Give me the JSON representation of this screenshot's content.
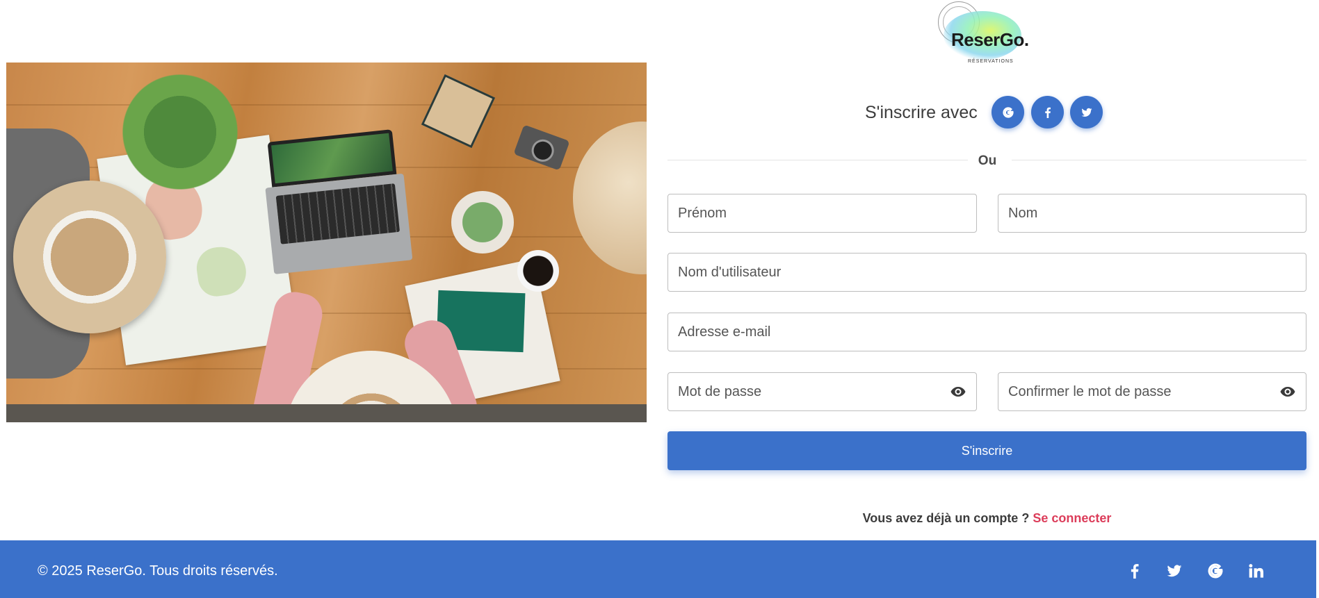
{
  "brand": {
    "name": "ReserGo.",
    "tagline": "RÉSERVATIONS"
  },
  "signup": {
    "social_title": "S'inscrire avec",
    "social_icons": [
      "google-icon",
      "facebook-icon",
      "twitter-icon"
    ],
    "divider_text": "Ou"
  },
  "form": {
    "first_name_placeholder": "Prénom",
    "last_name_placeholder": "Nom",
    "username_placeholder": "Nom d'utilisateur",
    "email_placeholder": "Adresse e-mail",
    "password_placeholder": "Mot de passe",
    "confirm_password_placeholder": "Confirmer le mot de passe",
    "submit_label": "S'inscrire"
  },
  "login_prompt": {
    "text": "Vous avez déjà un compte ?",
    "link": "Se connecter"
  },
  "footer": {
    "copyright": "© 2025 ReserGo. Tous droits réservés.",
    "social_icons": [
      "facebook-icon",
      "twitter-icon",
      "google-icon",
      "linkedin-icon"
    ]
  },
  "colors": {
    "primary": "#3b71ca",
    "link": "#dc3d5a",
    "footer_bg": "#3b71ca"
  }
}
